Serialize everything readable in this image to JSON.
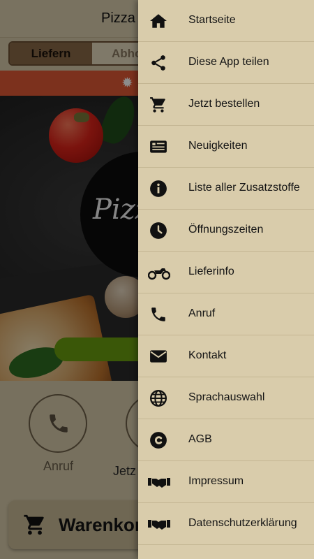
{
  "header": {
    "title": "Pizza"
  },
  "tabs": {
    "delivery_label": "Liefern",
    "pickup_label": "Abho"
  },
  "hero": {
    "logo_text": "Pizz"
  },
  "actions": {
    "call_label": "Anruf",
    "order_label": "Jetz"
  },
  "cart": {
    "label": "Warenkorb"
  },
  "drawer": {
    "items": [
      {
        "label": "Startseite",
        "icon": "home-icon"
      },
      {
        "label": "Diese App teilen",
        "icon": "share-icon"
      },
      {
        "label": "Jetzt bestellen",
        "icon": "cart-icon"
      },
      {
        "label": "Neuigkeiten",
        "icon": "newspaper-icon"
      },
      {
        "label": "Liste aller Zusatzstoffe",
        "icon": "info-icon"
      },
      {
        "label": "Öffnungszeiten",
        "icon": "clock-icon"
      },
      {
        "label": "Lieferinfo",
        "icon": "motorcycle-icon"
      },
      {
        "label": "Anruf",
        "icon": "phone-icon"
      },
      {
        "label": "Kontakt",
        "icon": "envelope-icon"
      },
      {
        "label": "Sprachauswahl",
        "icon": "globe-icon"
      },
      {
        "label": "AGB",
        "icon": "copyright-icon"
      },
      {
        "label": "Impressum",
        "icon": "handshake-icon"
      },
      {
        "label": "Datenschutzerklärung",
        "icon": "handshake-icon"
      }
    ]
  },
  "colors": {
    "drawer_bg": "#d9ccab",
    "notice_red": "#e25a35",
    "button_green": "#6b9f10",
    "tab_brown": "#8a6a48"
  }
}
